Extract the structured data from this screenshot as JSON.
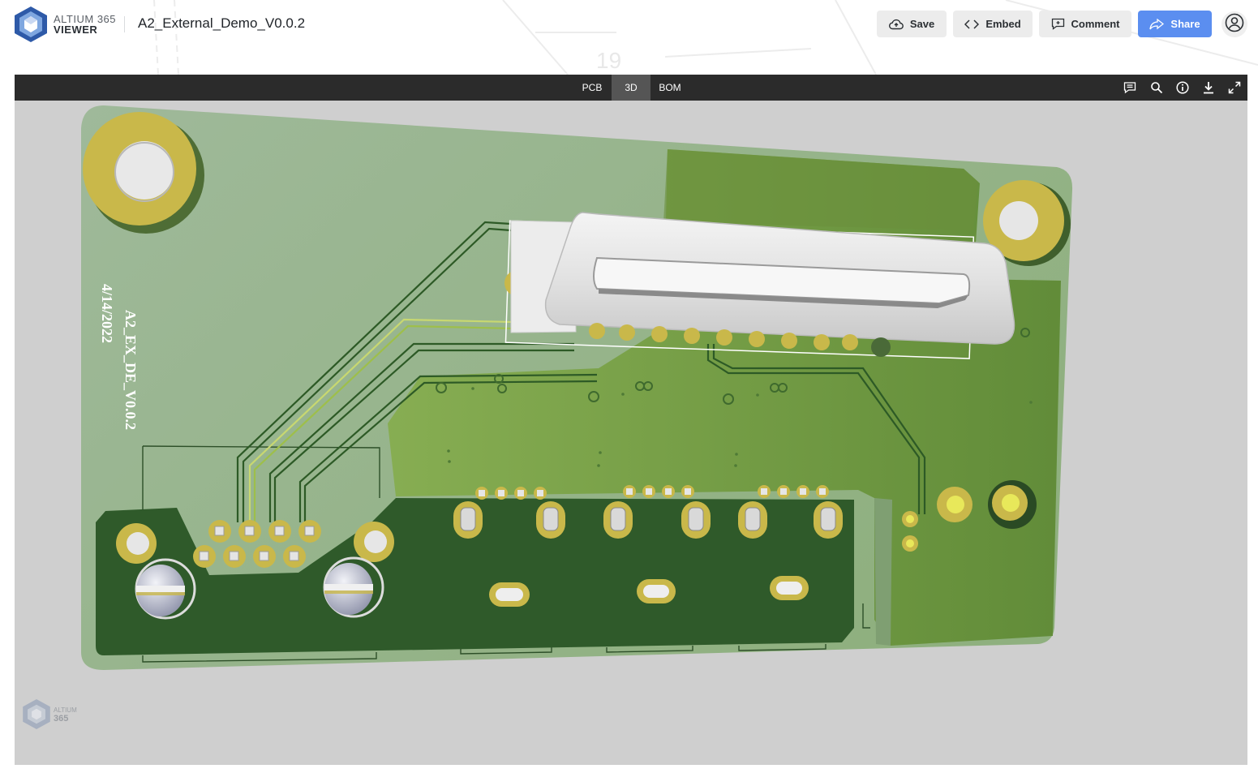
{
  "header": {
    "logo_line1": "ALTIUM 365",
    "logo_line2": "VIEWER",
    "doc_title": "A2_External_Demo_V0.0.2",
    "buttons": {
      "save": "Save",
      "embed": "Embed",
      "comment": "Comment",
      "share": "Share"
    }
  },
  "viewer": {
    "tabs": [
      "PCB",
      "3D",
      "BOM"
    ],
    "active_tab": "3D",
    "board_text_name": "A2_EX_DE_V0.0.2",
    "board_text_date": "4/14/2022",
    "watermark_line1": "ALTIUM",
    "watermark_line2": "365"
  },
  "colors": {
    "share_button": "#5b8ef0",
    "toolbar": "#2b2b2b",
    "active_tab": "#555555",
    "viewer_background": "#cfcfcf",
    "board_light": "#9db896",
    "board_dark": "#2f5a2a",
    "copper_pad": "#c9b84a"
  },
  "icons": [
    "comments-icon",
    "search-icon",
    "info-icon",
    "download-icon",
    "fullscreen-icon",
    "user-icon",
    "upload-icon",
    "code-icon",
    "comment-icon",
    "share-icon"
  ]
}
